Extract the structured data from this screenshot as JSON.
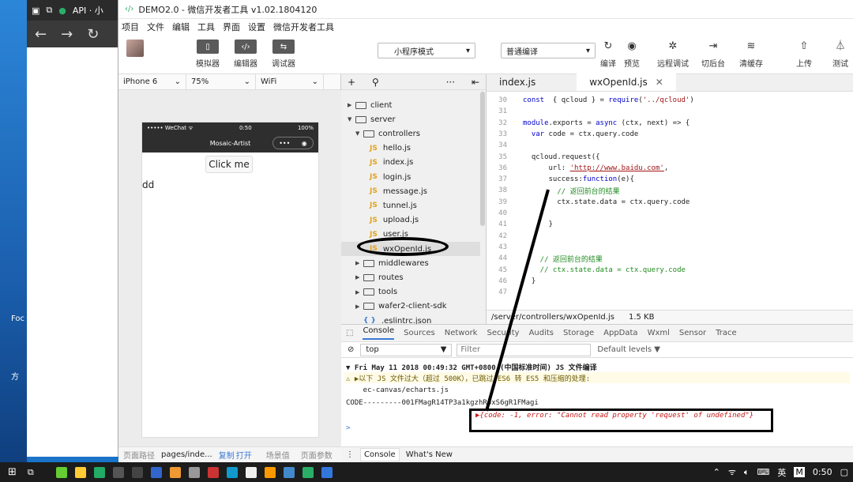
{
  "desktop": {
    "browser_tab": "API · 小",
    "labels": [
      "Foc",
      "方"
    ]
  },
  "window": {
    "title": "DEMO2.0 - 微信开发者工具 v1.02.1804120",
    "menu": [
      "项目",
      "文件",
      "编辑",
      "工具",
      "界面",
      "设置",
      "微信开发者工具"
    ]
  },
  "toolbar": {
    "simulator_label": "模拟器",
    "editor_label": "编辑器",
    "debugger_label": "调试器",
    "mode_select": "小程序模式",
    "compile_select": "普通编译",
    "compile_label": "编译",
    "preview_label": "预览",
    "remote_debug_label": "远程调试",
    "background_label": "切后台",
    "clear_cache_label": "清缓存",
    "upload_label": "上传",
    "test_label": "测试"
  },
  "simulator": {
    "device": "iPhone 6",
    "zoom": "75%",
    "network": "WiFi",
    "status_left": "••••• WeChat ᯤ",
    "status_time": "0:50",
    "status_battery": "100%",
    "nav_title": "Mosaic-Artist",
    "button_text": "Click me",
    "body_text": "dd",
    "footer_path_label": "页面路径",
    "footer_path": "pages/inde...",
    "footer_copy": "复制",
    "footer_open": "打开",
    "footer_scene": "场景值",
    "footer_params": "页面参数"
  },
  "tree": {
    "items": [
      {
        "name": "client",
        "kind": "folder",
        "open": false,
        "depth": 0
      },
      {
        "name": "server",
        "kind": "folder",
        "open": true,
        "depth": 0
      },
      {
        "name": "controllers",
        "kind": "folder",
        "open": true,
        "depth": 1
      },
      {
        "name": "hello.js",
        "kind": "js",
        "depth": 2
      },
      {
        "name": "index.js",
        "kind": "js",
        "depth": 2
      },
      {
        "name": "login.js",
        "kind": "js",
        "depth": 2
      },
      {
        "name": "message.js",
        "kind": "js",
        "depth": 2
      },
      {
        "name": "tunnel.js",
        "kind": "js",
        "depth": 2
      },
      {
        "name": "upload.js",
        "kind": "js",
        "depth": 2
      },
      {
        "name": "user.js",
        "kind": "js",
        "depth": 2
      },
      {
        "name": "wxOpenId.js",
        "kind": "js",
        "depth": 2,
        "selected": true
      },
      {
        "name": "middlewares",
        "kind": "folder",
        "open": false,
        "depth": 1
      },
      {
        "name": "routes",
        "kind": "folder",
        "open": false,
        "depth": 1
      },
      {
        "name": "tools",
        "kind": "folder",
        "open": false,
        "depth": 1
      },
      {
        "name": "wafer2-client-sdk",
        "kind": "folder",
        "open": false,
        "depth": 1
      },
      {
        "name": ".eslintrc.json",
        "kind": "json",
        "depth": 1
      }
    ]
  },
  "editor": {
    "tabs": [
      {
        "label": "index.js",
        "active": false
      },
      {
        "label": "wxOpenId.js",
        "active": true
      }
    ],
    "lines": [
      {
        "n": "30",
        "parts": [
          [
            "kw",
            "const"
          ],
          [
            "",
            "  { qcloud } = "
          ],
          [
            "kw",
            "require"
          ],
          [
            "",
            "("
          ],
          [
            "str",
            "'../qcloud'"
          ],
          [
            "",
            ")"
          ]
        ]
      },
      {
        "n": "31",
        "parts": []
      },
      {
        "n": "32",
        "parts": [
          [
            "kw",
            "module"
          ],
          [
            "",
            ".exports = "
          ],
          [
            "kw",
            "async"
          ],
          [
            "",
            " (ctx, next) => {"
          ]
        ]
      },
      {
        "n": "33",
        "parts": [
          [
            "",
            "  "
          ],
          [
            "kw",
            "var"
          ],
          [
            "",
            " code = ctx.query.code"
          ]
        ]
      },
      {
        "n": "34",
        "parts": []
      },
      {
        "n": "35",
        "parts": [
          [
            "",
            "  qcloud.request({"
          ]
        ]
      },
      {
        "n": "36",
        "parts": [
          [
            "",
            "      url: "
          ],
          [
            "url",
            "'http://www.baidu.com'"
          ],
          [
            "",
            ","
          ]
        ]
      },
      {
        "n": "37",
        "parts": [
          [
            "",
            "      success:"
          ],
          [
            "kw",
            "function"
          ],
          [
            "",
            "(e){"
          ]
        ]
      },
      {
        "n": "38",
        "parts": [
          [
            "cm",
            "        // 返回前台的结果"
          ]
        ]
      },
      {
        "n": "39",
        "parts": [
          [
            "",
            "        ctx.state.data = ctx.query.code"
          ]
        ]
      },
      {
        "n": "40",
        "parts": []
      },
      {
        "n": "41",
        "parts": [
          [
            "",
            "      }"
          ]
        ]
      },
      {
        "n": "42",
        "parts": []
      },
      {
        "n": "43",
        "parts": []
      },
      {
        "n": "44",
        "parts": [
          [
            "cm",
            "    // 返回前台的结果"
          ]
        ]
      },
      {
        "n": "45",
        "parts": [
          [
            "cm",
            "    // ctx.state.data = ctx.query.code"
          ]
        ]
      },
      {
        "n": "46",
        "parts": [
          [
            "",
            "  }"
          ]
        ]
      },
      {
        "n": "47",
        "parts": []
      }
    ],
    "status_path": "/server/controllers/wxOpenId.js",
    "status_size": "1.5 KB"
  },
  "devtools": {
    "tabs": [
      "Console",
      "Sources",
      "Network",
      "Security",
      "Audits",
      "Storage",
      "AppData",
      "Wxml",
      "Sensor",
      "Trace"
    ],
    "context": "top",
    "filter_placeholder": "Filter",
    "levels": "Default levels ▼",
    "log_time": "▼ Fri May 11 2018 00:49:32 GMT+0800 (中国标准时间) JS 文件编译",
    "log_warn": "⚠ ▶以下 JS 文件过大（超过 500K），已跳过 ES6 转 ES5 和压缩的处理:",
    "log_file": "    ec-canvas/echarts.js",
    "log_code": "CODE---------001FMagR14TP3a1kgzhR6xS6gR1FMagi",
    "log_error": "▶{code: -1, error: \"Cannot read property 'request' of undefined\"}",
    "prompt": ">",
    "bottom_tabs": [
      "Console",
      "What's New"
    ]
  },
  "taskbar": {
    "time": "0:50",
    "lang": "英",
    "ime": "M"
  }
}
